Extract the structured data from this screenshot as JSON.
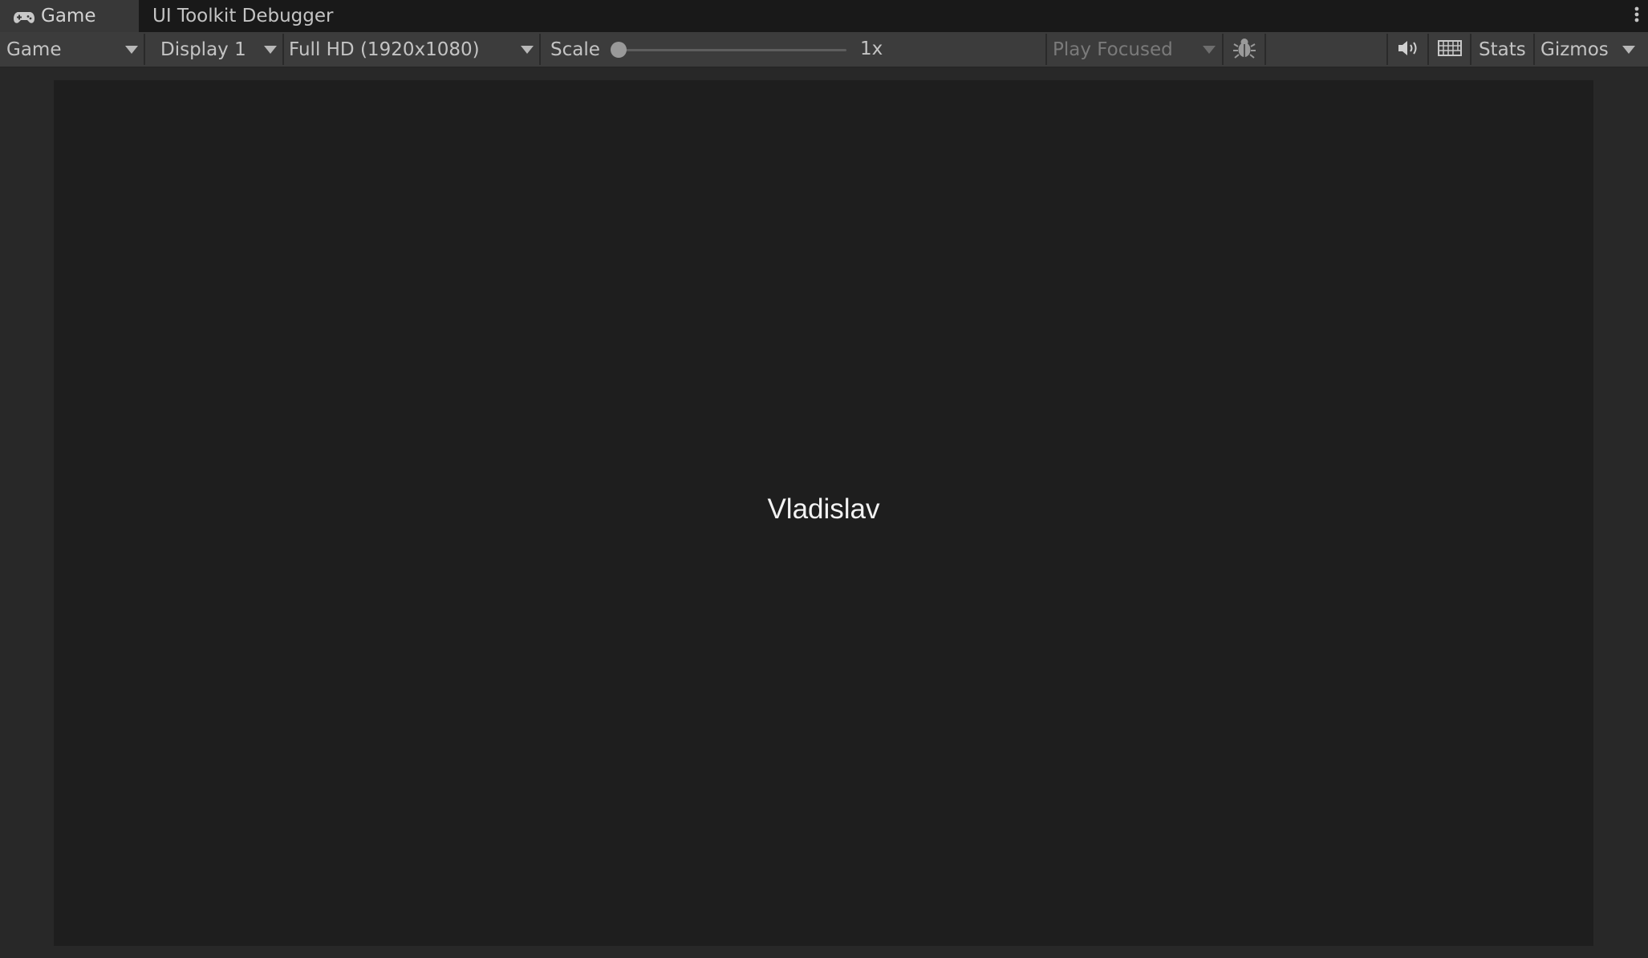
{
  "tabs": {
    "game_label": "Game",
    "game_icon": "gamepad-icon",
    "debugger_label": "UI Toolkit Debugger",
    "menu_icon": "kebab-menu-icon"
  },
  "toolbar": {
    "view_dropdown": "Game",
    "display_dropdown": "Display 1",
    "resolution_dropdown": "Full HD (1920x1080)",
    "scale_label": "Scale",
    "scale_value": "1x",
    "scale_level": 0,
    "play_mode_dropdown": "Play Focused",
    "bug_icon": "bug-icon",
    "audio_icon": "speaker-icon",
    "keyboard_icon": "keyboard-icon",
    "stats_label": "Stats",
    "gizmos_label": "Gizmos"
  },
  "game_view": {
    "center_text": "Vladislav",
    "background_color": "#1e1e1e"
  },
  "colors": {
    "tabbar": "#191919",
    "active_tab": "#383838",
    "toolbar": "#3c3c3c",
    "text": "#c4c4c4"
  }
}
